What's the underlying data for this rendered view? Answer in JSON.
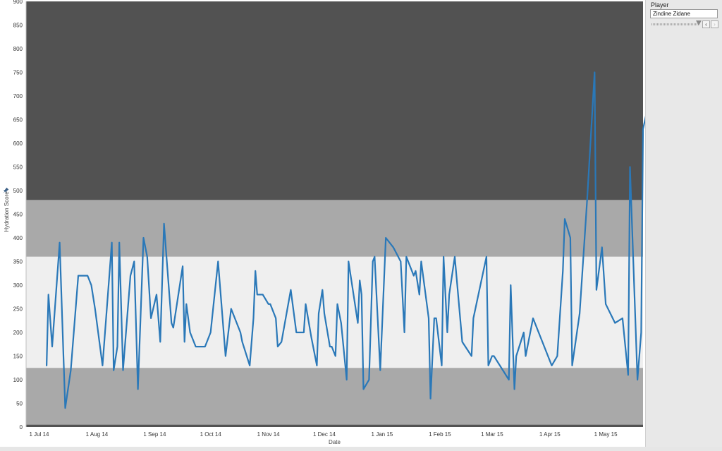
{
  "panel": {
    "title": "Player",
    "selected_player": "Zindine Zidane",
    "prev_symbol": "‹",
    "next_symbol": "›"
  },
  "pin_icon": "pin-icon",
  "colors": {
    "line": "#2a78b8",
    "band_dark": "#525252",
    "band_mid": "#a9a9a9",
    "band_light": "#efefef"
  },
  "chart_data": {
    "type": "line",
    "xlabel": "Date",
    "ylabel": "Hydration Score",
    "ylim": [
      0,
      900
    ],
    "xlim": [
      "2014-06-24",
      "2015-05-21"
    ],
    "yticks": [
      0,
      50,
      100,
      150,
      200,
      250,
      300,
      350,
      400,
      450,
      500,
      550,
      600,
      650,
      700,
      750,
      800,
      850,
      900
    ],
    "xticks": [
      {
        "date": "2014-07-01",
        "label": "1 Jul 14"
      },
      {
        "date": "2014-08-01",
        "label": "1 Aug 14"
      },
      {
        "date": "2014-09-01",
        "label": "1 Sep 14"
      },
      {
        "date": "2014-10-01",
        "label": "1 Oct 14"
      },
      {
        "date": "2014-11-01",
        "label": "1 Nov 14"
      },
      {
        "date": "2014-12-01",
        "label": "1 Dec 14"
      },
      {
        "date": "2015-01-01",
        "label": "1 Jan 15"
      },
      {
        "date": "2015-02-01",
        "label": "1 Feb 15"
      },
      {
        "date": "2015-03-01",
        "label": "1 Mar 15"
      },
      {
        "date": "2015-04-01",
        "label": "1 Apr 15"
      },
      {
        "date": "2015-05-01",
        "label": "1 May 15"
      }
    ],
    "bands": [
      {
        "from": 480,
        "to": 900,
        "color": "#525252"
      },
      {
        "from": 360,
        "to": 480,
        "color": "#a9a9a9"
      },
      {
        "from": 125,
        "to": 360,
        "color": "#efefef"
      },
      {
        "from": 5,
        "to": 125,
        "color": "#a9a9a9"
      },
      {
        "from": 0,
        "to": 5,
        "color": "#525252"
      }
    ],
    "series": [
      {
        "points": [
          [
            "2014-07-05",
            130
          ],
          [
            "2014-07-06",
            280
          ],
          [
            "2014-07-08",
            170
          ],
          [
            "2014-07-12",
            390
          ],
          [
            "2014-07-15",
            40
          ],
          [
            "2014-07-18",
            120
          ],
          [
            "2014-07-22",
            320
          ],
          [
            "2014-07-27",
            320
          ],
          [
            "2014-07-29",
            300
          ],
          [
            "2014-07-31",
            250
          ],
          [
            "2014-08-04",
            130
          ],
          [
            "2014-08-09",
            390
          ],
          [
            "2014-08-10",
            120
          ],
          [
            "2014-08-12",
            170
          ],
          [
            "2014-08-13",
            390
          ],
          [
            "2014-08-15",
            120
          ],
          [
            "2014-08-19",
            320
          ],
          [
            "2014-08-21",
            350
          ],
          [
            "2014-08-23",
            80
          ],
          [
            "2014-08-26",
            400
          ],
          [
            "2014-08-28",
            360
          ],
          [
            "2014-08-30",
            230
          ],
          [
            "2014-09-02",
            280
          ],
          [
            "2014-09-04",
            180
          ],
          [
            "2014-09-06",
            430
          ],
          [
            "2014-09-10",
            220
          ],
          [
            "2014-09-11",
            210
          ],
          [
            "2014-09-16",
            340
          ],
          [
            "2014-09-17",
            180
          ],
          [
            "2014-09-18",
            260
          ],
          [
            "2014-09-20",
            200
          ],
          [
            "2014-09-23",
            170
          ],
          [
            "2014-09-28",
            170
          ],
          [
            "2014-10-01",
            200
          ],
          [
            "2014-10-05",
            350
          ],
          [
            "2014-10-09",
            150
          ],
          [
            "2014-10-12",
            250
          ],
          [
            "2014-10-17",
            200
          ],
          [
            "2014-10-18",
            180
          ],
          [
            "2014-10-22",
            130
          ],
          [
            "2014-10-24",
            230
          ],
          [
            "2014-10-25",
            330
          ],
          [
            "2014-10-26",
            280
          ],
          [
            "2014-10-29",
            280
          ],
          [
            "2014-11-01",
            260
          ],
          [
            "2014-11-02",
            260
          ],
          [
            "2014-11-05",
            230
          ],
          [
            "2014-11-06",
            170
          ],
          [
            "2014-11-08",
            180
          ],
          [
            "2014-11-13",
            290
          ],
          [
            "2014-11-16",
            200
          ],
          [
            "2014-11-20",
            200
          ],
          [
            "2014-11-21",
            260
          ],
          [
            "2014-11-24",
            190
          ],
          [
            "2014-11-27",
            130
          ],
          [
            "2014-11-28",
            240
          ],
          [
            "2014-11-30",
            290
          ],
          [
            "2014-12-01",
            240
          ],
          [
            "2014-12-04",
            170
          ],
          [
            "2014-12-05",
            170
          ],
          [
            "2014-12-07",
            150
          ],
          [
            "2014-12-08",
            260
          ],
          [
            "2014-12-10",
            220
          ],
          [
            "2014-12-13",
            100
          ],
          [
            "2014-12-14",
            350
          ],
          [
            "2014-12-19",
            220
          ],
          [
            "2014-12-20",
            310
          ],
          [
            "2014-12-21",
            280
          ],
          [
            "2014-12-22",
            80
          ],
          [
            "2014-12-25",
            100
          ],
          [
            "2014-12-27",
            350
          ],
          [
            "2014-12-28",
            360
          ],
          [
            "2014-12-31",
            120
          ],
          [
            "2015-01-03",
            400
          ],
          [
            "2015-01-07",
            380
          ],
          [
            "2015-01-11",
            350
          ],
          [
            "2015-01-13",
            200
          ],
          [
            "2015-01-14",
            360
          ],
          [
            "2015-01-18",
            320
          ],
          [
            "2015-01-19",
            330
          ],
          [
            "2015-01-21",
            280
          ],
          [
            "2015-01-22",
            350
          ],
          [
            "2015-01-26",
            230
          ],
          [
            "2015-01-27",
            60
          ],
          [
            "2015-01-29",
            230
          ],
          [
            "2015-01-30",
            230
          ],
          [
            "2015-02-02",
            130
          ],
          [
            "2015-02-03",
            360
          ],
          [
            "2015-02-05",
            200
          ],
          [
            "2015-02-06",
            280
          ],
          [
            "2015-02-09",
            360
          ],
          [
            "2015-02-13",
            180
          ],
          [
            "2015-02-18",
            150
          ],
          [
            "2015-02-19",
            230
          ],
          [
            "2015-02-26",
            360
          ],
          [
            "2015-02-27",
            130
          ],
          [
            "2015-03-01",
            150
          ],
          [
            "2015-03-02",
            150
          ],
          [
            "2015-03-10",
            100
          ],
          [
            "2015-03-11",
            300
          ],
          [
            "2015-03-13",
            80
          ],
          [
            "2015-03-14",
            150
          ],
          [
            "2015-03-18",
            200
          ],
          [
            "2015-03-19",
            150
          ],
          [
            "2015-03-23",
            230
          ],
          [
            "2015-03-31",
            150
          ],
          [
            "2015-04-02",
            130
          ],
          [
            "2015-04-05",
            150
          ],
          [
            "2015-04-08",
            330
          ],
          [
            "2015-04-09",
            440
          ],
          [
            "2015-04-12",
            400
          ],
          [
            "2015-04-13",
            130
          ],
          [
            "2015-04-17",
            240
          ],
          [
            "2015-04-21",
            480
          ],
          [
            "2015-04-25",
            750
          ],
          [
            "2015-04-26",
            290
          ],
          [
            "2015-04-29",
            380
          ],
          [
            "2015-05-01",
            260
          ],
          [
            "2015-05-06",
            220
          ],
          [
            "2015-05-10",
            230
          ],
          [
            "2015-05-13",
            110
          ],
          [
            "2015-05-14",
            550
          ],
          [
            "2015-05-18",
            100
          ],
          [
            "2015-05-20",
            200
          ],
          [
            "2015-05-21",
            630
          ],
          [
            "2015-05-26",
            720
          ]
        ]
      }
    ]
  }
}
